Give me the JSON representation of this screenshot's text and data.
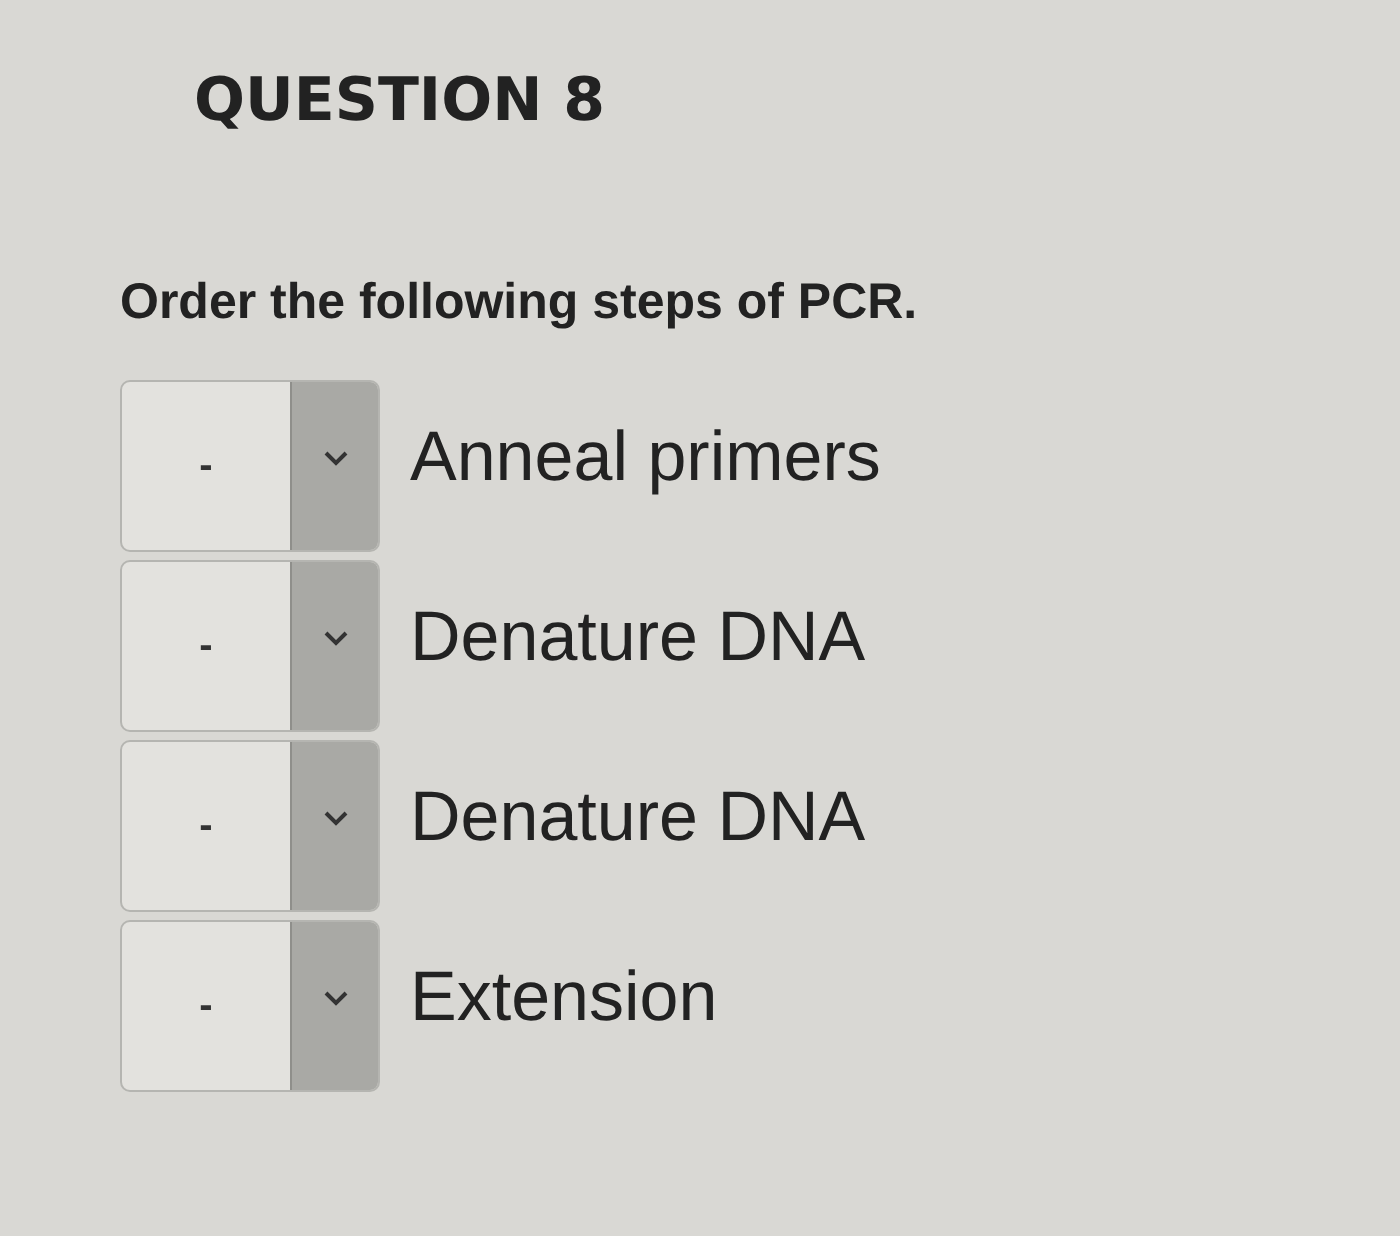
{
  "question": {
    "title": "QUESTION 8",
    "prompt": "Order the following steps of PCR."
  },
  "steps": [
    {
      "value": "-",
      "label": "Anneal primers"
    },
    {
      "value": "-",
      "label": "Denature DNA"
    },
    {
      "value": "-",
      "label": "Denature DNA"
    },
    {
      "value": "-",
      "label": "Extension"
    }
  ]
}
